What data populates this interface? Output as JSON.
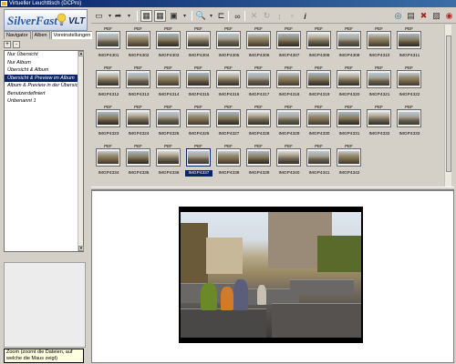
{
  "window": {
    "title": "Virtueller Leuchttisch (DCPro)"
  },
  "logo": {
    "brand": "SilverFast",
    "product": "VLT"
  },
  "tabs": [
    {
      "label": "Navigator"
    },
    {
      "label": "Alben"
    },
    {
      "label": "Voreinstellungen"
    }
  ],
  "panel_buttons": [
    "+",
    "-"
  ],
  "presets": [
    {
      "label": "Nur Übersicht"
    },
    {
      "label": "Nur Album"
    },
    {
      "label": "Übersicht & Album"
    },
    {
      "label": "Übersicht & Preview im Album",
      "selected": true
    },
    {
      "label": "Album & Preview in der Übersicht"
    },
    {
      "label": "Benutzerdefiniert"
    },
    {
      "label": "Unbenannt 1"
    }
  ],
  "thumbnails": [
    {
      "name": "IMGP4301",
      "type": "PEF"
    },
    {
      "name": "IMGP4302",
      "type": "PEF"
    },
    {
      "name": "IMGP4303",
      "type": "PEF"
    },
    {
      "name": "IMGP4304",
      "type": "PEF"
    },
    {
      "name": "IMGP4305",
      "type": "PEF"
    },
    {
      "name": "IMGP4306",
      "type": "PEF"
    },
    {
      "name": "IMGP4307",
      "type": "PEF"
    },
    {
      "name": "IMGP4308",
      "type": "PEF"
    },
    {
      "name": "IMGP4309",
      "type": "PEF"
    },
    {
      "name": "IMGP4310",
      "type": "PEF"
    },
    {
      "name": "IMGP4311",
      "type": "PEF"
    },
    {
      "name": "IMGP4312",
      "type": "PEF"
    },
    {
      "name": "IMGP4313",
      "type": "PEF"
    },
    {
      "name": "IMGP4314",
      "type": "PEF"
    },
    {
      "name": "IMGP4315",
      "type": "PEF"
    },
    {
      "name": "IMGP4316",
      "type": "PEF"
    },
    {
      "name": "IMGP4317",
      "type": "PEF"
    },
    {
      "name": "IMGP4318",
      "type": "PEF"
    },
    {
      "name": "IMGP4319",
      "type": "PEF"
    },
    {
      "name": "IMGP4320",
      "type": "PEF"
    },
    {
      "name": "IMGP4321",
      "type": "PEF"
    },
    {
      "name": "IMGP4322",
      "type": "PEF"
    },
    {
      "name": "IMGP4323",
      "type": "PEF"
    },
    {
      "name": "IMGP4324",
      "type": "PEF"
    },
    {
      "name": "IMGP4325",
      "type": "PEF"
    },
    {
      "name": "IMGP4326",
      "type": "PEF"
    },
    {
      "name": "IMGP4327",
      "type": "PEF"
    },
    {
      "name": "IMGP4328",
      "type": "PEF"
    },
    {
      "name": "IMGP4329",
      "type": "PEF"
    },
    {
      "name": "IMGP4330",
      "type": "PEF"
    },
    {
      "name": "IMGP4331",
      "type": "PEF"
    },
    {
      "name": "IMGP4332",
      "type": "PEF"
    },
    {
      "name": "IMGP4333",
      "type": "PEF"
    },
    {
      "name": "IMGP4334",
      "type": "PEF"
    },
    {
      "name": "IMGP4335",
      "type": "PEF"
    },
    {
      "name": "IMGP4336",
      "type": "PEF"
    },
    {
      "name": "IMGP4337",
      "type": "PEF",
      "selected": true
    },
    {
      "name": "IMGP4338",
      "type": "PEF"
    },
    {
      "name": "IMGP4339",
      "type": "PEF"
    },
    {
      "name": "IMGP4340",
      "type": "PEF"
    },
    {
      "name": "IMGP4341",
      "type": "PEF"
    },
    {
      "name": "IMGP4342",
      "type": "PEF"
    }
  ],
  "status": {
    "tooltip": "Zoom (zoomt die Dateien, auf welche die Maus zeigt)"
  },
  "toolbar": {
    "icons": [
      "new-icon",
      "export-icon",
      "grid-small-icon",
      "grid-large-icon",
      "image-view-icon",
      "zoom-icon",
      "crop-icon",
      "binoculars-icon",
      "close-x-icon",
      "rotate-icon",
      "sort-icon",
      "format-icon",
      "info-icon",
      "globe-icon",
      "clipboard-icon",
      "delete-icon",
      "image-icon",
      "eye-icon"
    ]
  },
  "colors": {
    "selection": "#0a246a",
    "window_bg": "#d4d0c8"
  }
}
